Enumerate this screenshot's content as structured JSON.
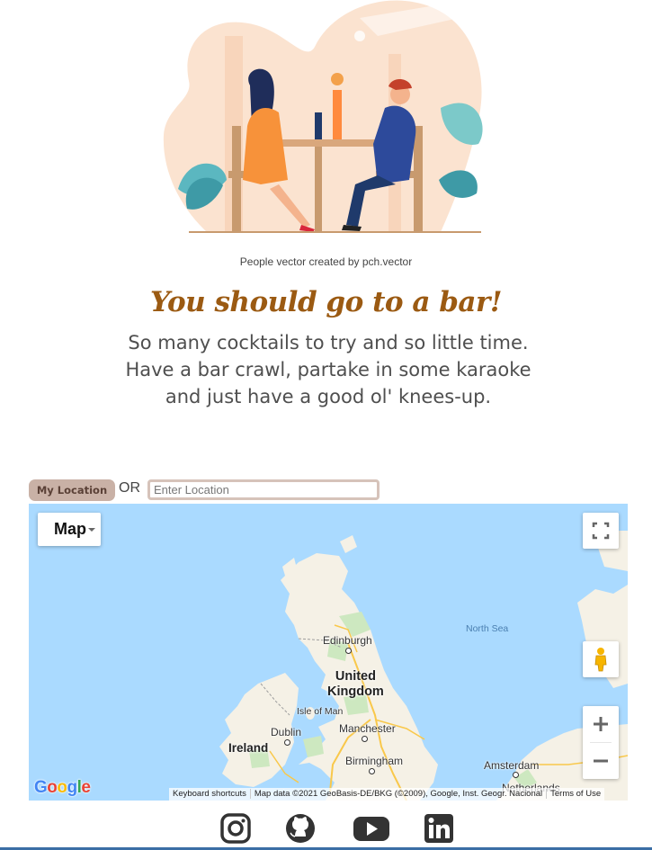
{
  "hero": {
    "image_icon": "dinner-date-illustration",
    "credit": "People vector created by pch.vector"
  },
  "headline": "You should go to a bar!",
  "blurb": "So many cocktails to try and so little time. Have a bar crawl, partake in some karaoke and just have a good ol' knees-up.",
  "location": {
    "my_location_label": "My Location",
    "or_label": "OR",
    "input_placeholder": "Enter Location",
    "input_value": ""
  },
  "map": {
    "map_type_label": "Map",
    "labels": {
      "north_sea": "North Sea",
      "edinburgh": "Edinburgh",
      "united_kingdom_line1": "United",
      "united_kingdom_line2": "Kingdom",
      "isle_of_man": "Isle of Man",
      "dublin": "Dublin",
      "manchester": "Manchester",
      "ireland": "Ireland",
      "birmingham": "Birmingham",
      "amsterdam": "Amsterdam",
      "netherlands": "Netherlands"
    },
    "google_logo": "Google",
    "keyboard_shortcuts": "Keyboard shortcuts",
    "map_data": "Map data ©2021 GeoBasis-DE/BKG (©2009), Google, Inst. Geogr. Nacional",
    "terms": "Terms of Use",
    "colors": {
      "water": "#aadaff",
      "land": "#f5f1e6",
      "park": "#cde8c0"
    }
  },
  "social": {
    "icons": [
      "instagram-icon",
      "github-icon",
      "youtube-icon",
      "linkedin-icon"
    ]
  },
  "colors": {
    "headline": "#9b5a12",
    "button_bg": "#c9b1a6",
    "input_border": "#d6c3ba",
    "bottom_bar": "#3b6ea5"
  }
}
